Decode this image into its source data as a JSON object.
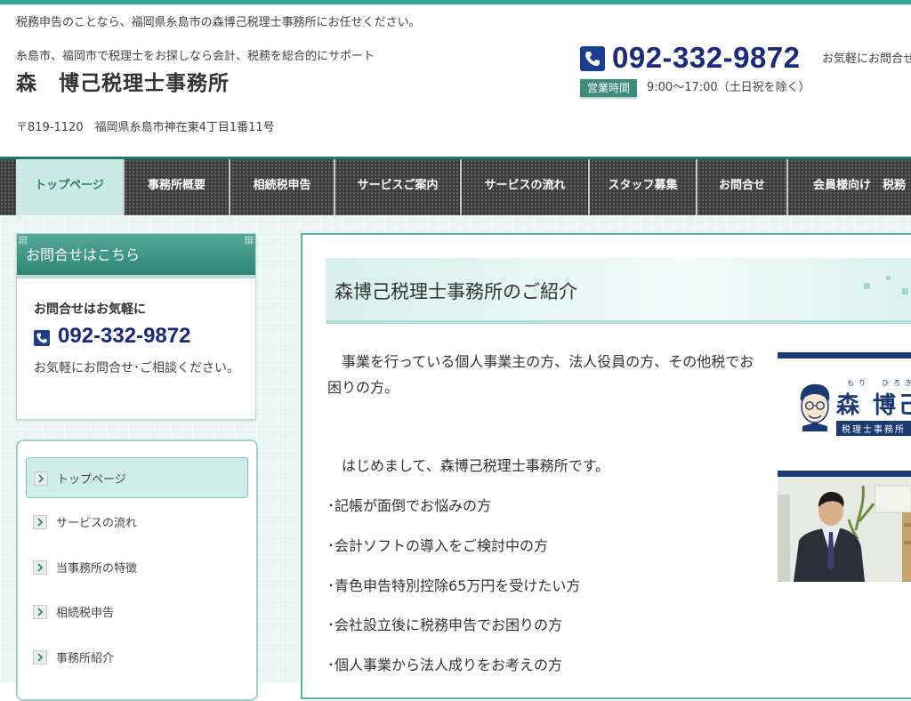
{
  "header": {
    "site_description": "税務申告のことなら、福岡県糸島市の森博己税理士事務所にお任せください。",
    "catchcopy": "糸島市、福岡市で税理士をお探しなら会計、税務を総合的にサポート",
    "logo_text": "森　博己税理士事務所",
    "address": "〒819-1120　福岡県糸島市神在東4丁目1番11号",
    "phone": "092-332-9872",
    "contact_note": "お気軽にお問合せ",
    "hours_label": "営業時間",
    "hours_text": "9:00～17:00（土日祝を除く）"
  },
  "gnav": {
    "items": [
      {
        "label": "トップページ",
        "active": true
      },
      {
        "label": "事務所概要"
      },
      {
        "label": "相続税申告"
      },
      {
        "label": "サービスご案内"
      },
      {
        "label": "サービスの流れ"
      },
      {
        "label": "スタッフ募集"
      },
      {
        "label": "お問合せ"
      },
      {
        "label": "会員様向け　税務"
      }
    ]
  },
  "sidebar": {
    "contact_box": {
      "title": "お問合せはこちら",
      "subtitle": "お問合せはお気軽に",
      "phone": "092-332-9872",
      "note": "お気軽にお問合せ･ご相談ください。"
    },
    "menu": [
      {
        "label": "トップページ",
        "active": true
      },
      {
        "label": "サービスの流れ"
      },
      {
        "label": "当事務所の特徴"
      },
      {
        "label": "相続税申告"
      },
      {
        "label": "事務所紹介"
      }
    ]
  },
  "main": {
    "title": "森博己税理士事務所のご紹介",
    "intro": "　事業を行っている個人事業主の方、法人役員の方、その他税でお困りの方。",
    "greeting": "　はじめまして、森博己税理士事務所です。",
    "bullets": [
      "･記帳が面倒でお悩みの方",
      "･会計ソフトの導入をご検討中の方",
      "･青色申告特別控除65万円を受けたい方",
      "･会社設立後に税務申告でお困りの方",
      "･個人事業から法人成りをお考えの方"
    ],
    "logo_card": {
      "ruby": "もり　ひろき",
      "name": "森 博己",
      "sub": "税理士事務所"
    }
  },
  "colors": {
    "accent": "#2fa89a",
    "phone": "#1c2a7a",
    "logo_navy": "#1b3a73"
  }
}
